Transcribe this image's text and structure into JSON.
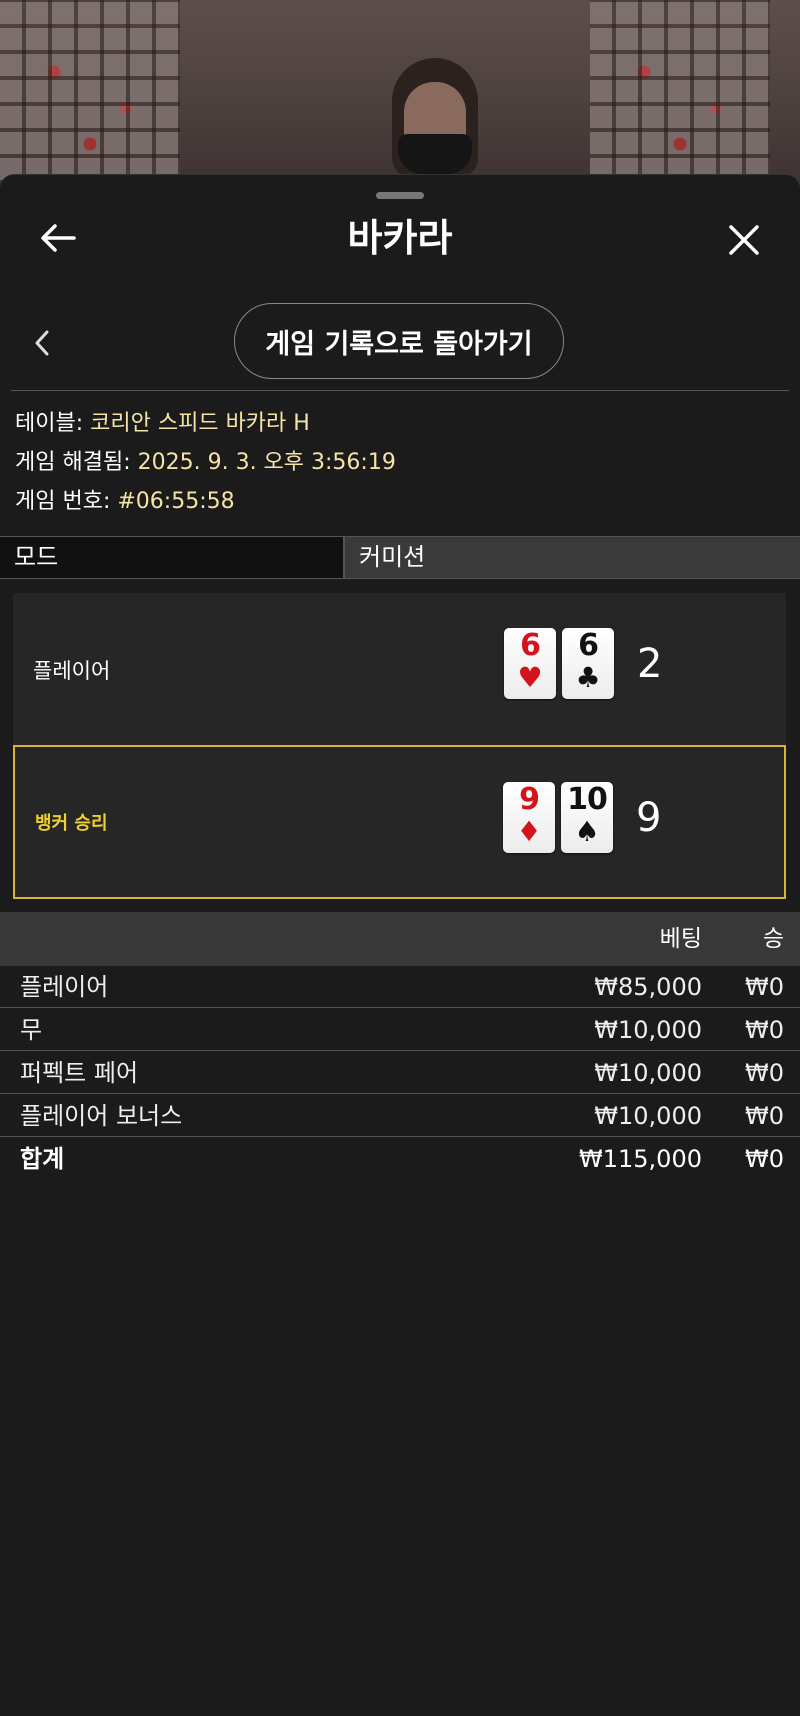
{
  "header": {
    "title": "바카라",
    "back_icon": "arrow-left-icon",
    "close_icon": "close-icon"
  },
  "nav": {
    "prev_icon": "chevron-left-icon",
    "back_to_history_label": "게임 기록으로 돌아가기"
  },
  "info": {
    "table_label": "테이블:",
    "table_value": "코리안 스피드 바카라 H",
    "resolved_label": "게임 해결됨:",
    "resolved_value": "2025. 9. 3. 오후 3:56:19",
    "game_no_label": "게임 번호:",
    "game_no_value": "#06:55:58"
  },
  "mode": {
    "mode_label": "모드",
    "commission_label": "커미션"
  },
  "hands": {
    "player": {
      "label": "플레이어",
      "score": "2",
      "cards": [
        {
          "rank": "6",
          "suit": "♥",
          "color": "red"
        },
        {
          "rank": "6",
          "suit": "♣",
          "color": "black"
        }
      ]
    },
    "banker": {
      "label": "뱅커 승리",
      "score": "9",
      "cards": [
        {
          "rank": "9",
          "suit": "♦",
          "color": "red"
        },
        {
          "rank": "10",
          "suit": "♠",
          "color": "black"
        }
      ]
    }
  },
  "bets": {
    "col_bet": "베팅",
    "col_win": "승",
    "rows": [
      {
        "name": "플레이어",
        "bet": "₩85,000",
        "win": "₩0"
      },
      {
        "name": "무",
        "bet": "₩10,000",
        "win": "₩0"
      },
      {
        "name": "퍼펙트 페어",
        "bet": "₩10,000",
        "win": "₩0"
      },
      {
        "name": "플레이어 보너스",
        "bet": "₩10,000",
        "win": "₩0"
      }
    ],
    "total": {
      "name": "합계",
      "bet": "₩115,000",
      "win": "₩0"
    }
  },
  "colors": {
    "accent_gold": "#d4b534",
    "value_text": "#f4e4a6",
    "sheet_bg": "#1b1b1b"
  }
}
